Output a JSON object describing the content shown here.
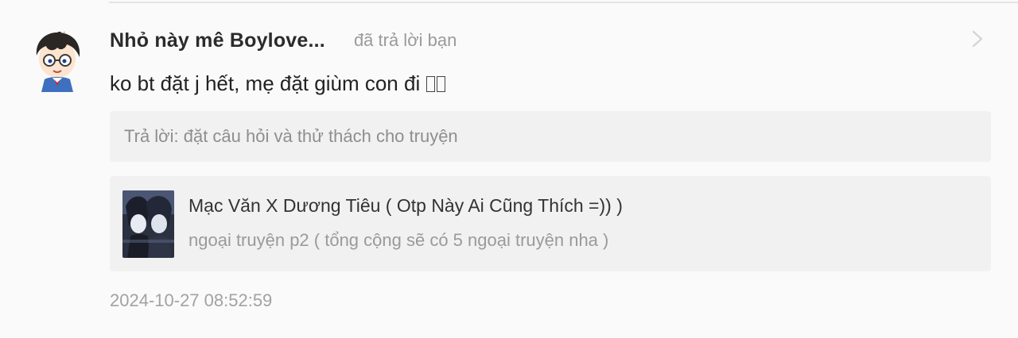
{
  "notification": {
    "username": "Nhỏ này mê Boylove...",
    "action": "đã trả lời bạn",
    "comment": "ko bt đặt j hết, mẹ đặt giùm con đi",
    "reply_preview": "Trả lời: đặt câu hỏi và thử thách cho truyện",
    "story": {
      "title": "Mạc Văn X Dương Tiêu ( Otp Này Ai Cũng Thích =)) )",
      "chapter": "ngoại truyện p2 ( tổng cộng sẽ có 5 ngoại truyện nha )"
    },
    "timestamp": "2024-10-27 08:52:59"
  },
  "icons": {
    "avatar": "cartoon-avatar-icon",
    "chevron": "chevron-right-icon",
    "cover": "story-cover-image"
  },
  "colors": {
    "background": "#fafafa",
    "card": "#f1f1f1",
    "username": "#2b2b2b",
    "muted": "#9a9a9a"
  }
}
